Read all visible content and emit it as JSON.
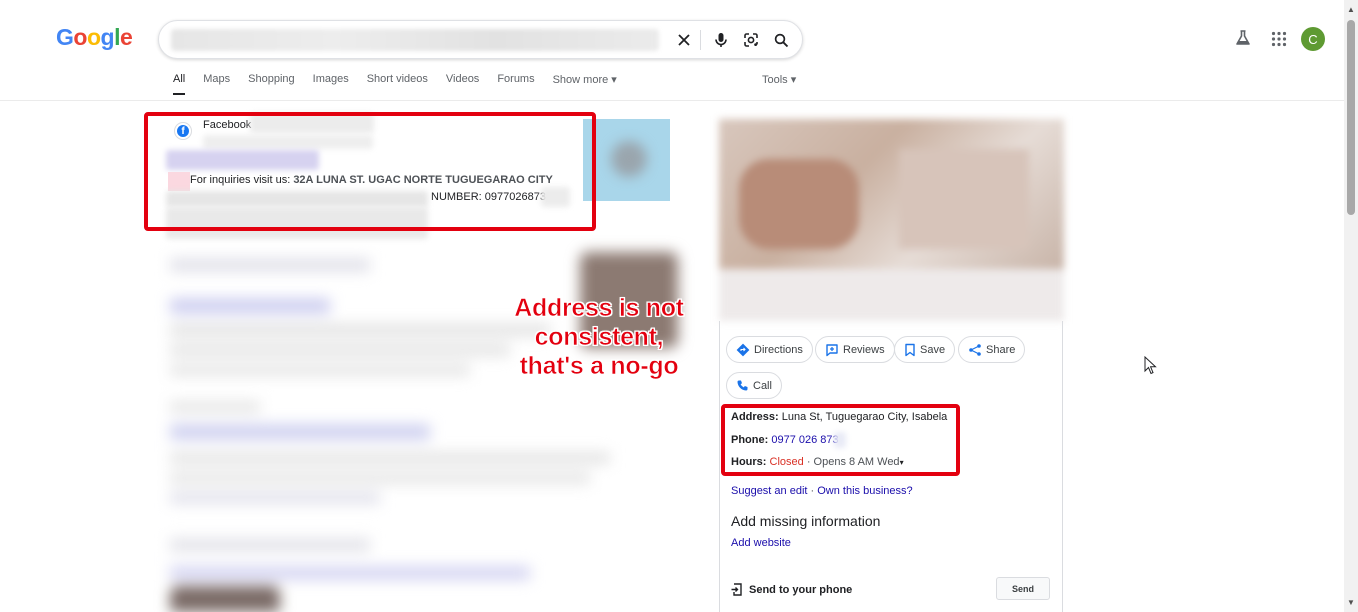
{
  "header": {
    "logo_letters": [
      {
        "ch": "G",
        "color": "#4285f4"
      },
      {
        "ch": "o",
        "color": "#ea4335"
      },
      {
        "ch": "o",
        "color": "#fbbc05"
      },
      {
        "ch": "g",
        "color": "#4285f4"
      },
      {
        "ch": "l",
        "color": "#34a853"
      },
      {
        "ch": "e",
        "color": "#ea4335"
      }
    ],
    "avatar_initial": "C",
    "avatar_color": "#5e9a32",
    "tabs": [
      {
        "label": "All",
        "active": true
      },
      {
        "label": "Maps"
      },
      {
        "label": "Shopping"
      },
      {
        "label": "Images"
      },
      {
        "label": "Short videos"
      },
      {
        "label": "Videos"
      },
      {
        "label": "Forums"
      },
      {
        "label": "Show more ▾"
      }
    ],
    "tools_label": "Tools ▾",
    "icons": [
      "clear-icon",
      "mic-icon",
      "lens-icon",
      "search-icon",
      "labs-icon",
      "apps-icon"
    ]
  },
  "result": {
    "source": "Facebook",
    "snippet_prefix": "For inquiries visit us: ",
    "snippet_address": "32A LUNA ST. UGAC NORTE TUGUEGARAO CITY",
    "snippet_number": "NUMBER: 0977026873"
  },
  "annotation": {
    "line1": "Address is not",
    "line2": "consistent,",
    "line3": "that's a no-go",
    "color": "#e3000f"
  },
  "knowledge_panel": {
    "actions": {
      "directions": "Directions",
      "reviews": "Reviews",
      "save": "Save",
      "share": "Share",
      "call": "Call"
    },
    "address_label": "Address:",
    "address_value": "Luna St, Tuguegarao City, Isabela",
    "phone_label": "Phone:",
    "phone_value": "0977 026 873",
    "hours_label": "Hours:",
    "hours_status": "Closed",
    "hours_detail": " · Opens 8 AM Wed",
    "hours_caret": "▾",
    "suggest_edit": "Suggest an edit",
    "separator": " · ",
    "own_business": "Own this business?",
    "add_missing": "Add missing information",
    "add_website": "Add website",
    "send_to_phone": "Send to your phone",
    "send_button": "Send"
  }
}
